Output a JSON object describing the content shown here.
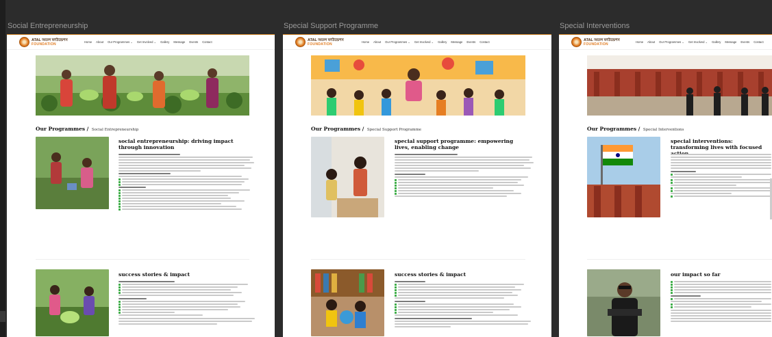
{
  "frames": [
    {
      "label": "Social Entrepreneurship",
      "logo": {
        "line1": "ATAL অতল ফাউন্ডেশন",
        "line2": "FOUNDATION"
      },
      "menu": [
        "Home",
        "About",
        "Our Programmes ⌄",
        "Get Involved ⌄",
        "Gallery",
        "Message",
        "Events",
        "Contact"
      ],
      "heading_main": "Our Programmes /",
      "heading_sub": "Social Entrepreneurship",
      "section1_title": "social entrepreneurship: driving impact through innovation",
      "section2_title": "success stories & impact"
    },
    {
      "label": "Special Support Programme",
      "logo": {
        "line1": "ATAL অতল ফাউন্ডেশন",
        "line2": "FOUNDATION"
      },
      "menu": [
        "Home",
        "About",
        "Our Programmes ⌄",
        "Get Involved ⌄",
        "Gallery",
        "Message",
        "Events",
        "Contact"
      ],
      "heading_main": "Our Programmes /",
      "heading_sub": "Special Support Programme",
      "section1_title": "special support programme: empowering lives, enabling change",
      "section2_title": "success stories & impact"
    },
    {
      "label": "Special Interventions",
      "logo": {
        "line1": "ATAL অতল ফাউন্ডেশন",
        "line2": "FOUNDATION"
      },
      "menu": [
        "Home",
        "About",
        "Our Programmes ⌄",
        "Get Involved ⌄",
        "Gallery",
        "Message",
        "Events",
        "Contact"
      ],
      "heading_main": "Our Programmes /",
      "heading_sub": "Special Interventions",
      "section1_title": "special interventions: transforming lives with focused action",
      "section2_title": "our impact so far"
    }
  ],
  "colors": {
    "accent": "#e07a1f",
    "check": "#3fae49",
    "canvas": "#2c2c2c"
  },
  "icons": {
    "check": "check-square-icon",
    "logo": "atal-foundation-logo"
  }
}
